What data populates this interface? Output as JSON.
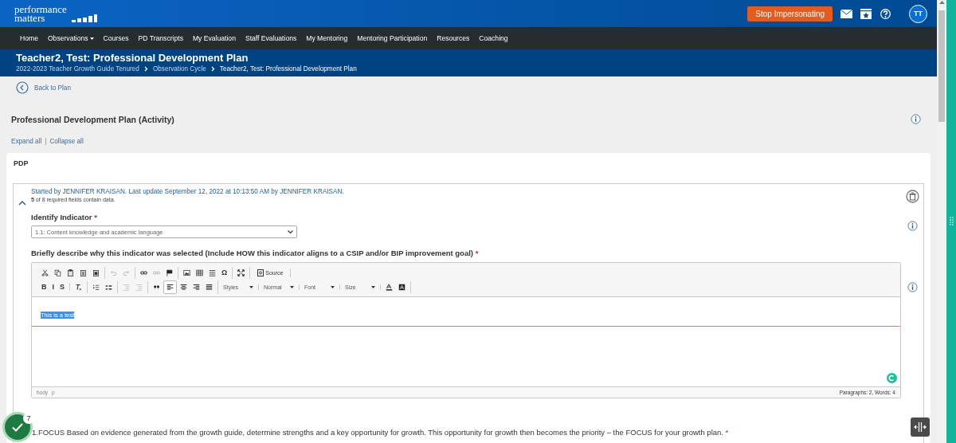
{
  "header": {
    "logo_line1": "performance",
    "logo_line2": "matters",
    "stop_button": "Stop Impersonating",
    "avatar": "TT"
  },
  "nav": [
    {
      "label": "Home",
      "dropdown": false
    },
    {
      "label": "Observations",
      "dropdown": true
    },
    {
      "label": "Courses",
      "dropdown": false
    },
    {
      "label": "PD Transcripts",
      "dropdown": false
    },
    {
      "label": "My Evaluation",
      "dropdown": false
    },
    {
      "label": "Staff Evaluations",
      "dropdown": false
    },
    {
      "label": "My Mentoring",
      "dropdown": false
    },
    {
      "label": "Mentoring Participation",
      "dropdown": false
    },
    {
      "label": "Resources",
      "dropdown": false
    },
    {
      "label": "Coaching",
      "dropdown": false
    }
  ],
  "title_bar": {
    "title": "Teacher2, Test: Professional Development Plan",
    "breadcrumbs": [
      "2022-2023 Teacher Growth Guide Tenured",
      "Observation Cycle",
      "Teacher2, Test: Professional Development Plan"
    ]
  },
  "back_link": "Back to Plan",
  "page_heading": "Professional Development Plan (Activity)",
  "expand_all": "Expand all",
  "separator": "|",
  "collapse_all": "Collapse all",
  "card": {
    "title": "PDP",
    "section": {
      "expanded": true,
      "started_by": "Started by JENNIFER KRAISAN. Last update September 12, 2022 at 10:13:50 AM by JENNIFER KRAISAN.",
      "required_note": "**5** of 8 required fields contain data.",
      "indicator_label": "Identify Indicator",
      "required_mark": "*",
      "indicator_value": "1.1: Content knowledge and academic language",
      "describe_label": "Briefly describe why this indicator was selected (Include HOW this indicator aligns to a CSIP and/or BIP improvement goal)",
      "editor": {
        "toolbar": [
          [
            [
              {
                "kind": "cut"
              },
              {
                "kind": "copy"
              },
              {
                "kind": "paste"
              },
              {
                "kind": "paste-text"
              },
              {
                "kind": "paste-word"
              }
            ],
            [
              {
                "kind": "undo"
              },
              {
                "kind": "redo"
              }
            ],
            [
              {
                "kind": "link"
              },
              {
                "kind": "unlink"
              },
              {
                "kind": "flag"
              }
            ],
            [
              {
                "kind": "image"
              },
              {
                "kind": "table"
              },
              {
                "kind": "hr"
              },
              {
                "kind": "glyph",
                "label": "Ω"
              }
            ],
            [
              {
                "kind": "maximize"
              }
            ],
            [
              {
                "kind": "source",
                "label": "Source"
              }
            ]
          ],
          [
            [
              {
                "kind": "glyph",
                "label": "B"
              },
              {
                "kind": "glyph",
                "label": "I"
              },
              {
                "kind": "glyph",
                "label": "S"
              }
            ],
            [
              {
                "kind": "clear-format"
              }
            ],
            [
              {
                "kind": "ol"
              },
              {
                "kind": "ul"
              }
            ],
            [
              {
                "kind": "outdent"
              },
              {
                "kind": "indent"
              }
            ],
            [
              {
                "kind": "quote"
              },
              {
                "kind": "align-left",
                "selected": true
              },
              {
                "kind": "align-center",
                "selected": false
              },
              {
                "kind": "align-right",
                "selected": false
              },
              {
                "kind": "align-justify",
                "selected": false
              }
            ],
            [
              {
                "kind": "combo",
                "label": "Styles"
              }
            ],
            [
              {
                "kind": "combo",
                "label": "Normal"
              }
            ],
            [
              {
                "kind": "combo",
                "label": "Font"
              }
            ],
            [
              {
                "kind": "combo",
                "label": "Size"
              }
            ],
            [
              {
                "kind": "text-color"
              },
              {
                "kind": "bg-color"
              }
            ]
          ]
        ],
        "content": "This is a test",
        "path": [
          "body",
          "p"
        ],
        "stats": "Paragraphs: 2, Words: 4"
      }
    },
    "focus_label": "1.FOCUS Based on evidence generated from the growth guide, determine strengths and a key opportunity for growth. This opportunity for growth then becomes the priority – the FOCUS for your growth plan."
  },
  "status_badge": {
    "count": "7"
  }
}
